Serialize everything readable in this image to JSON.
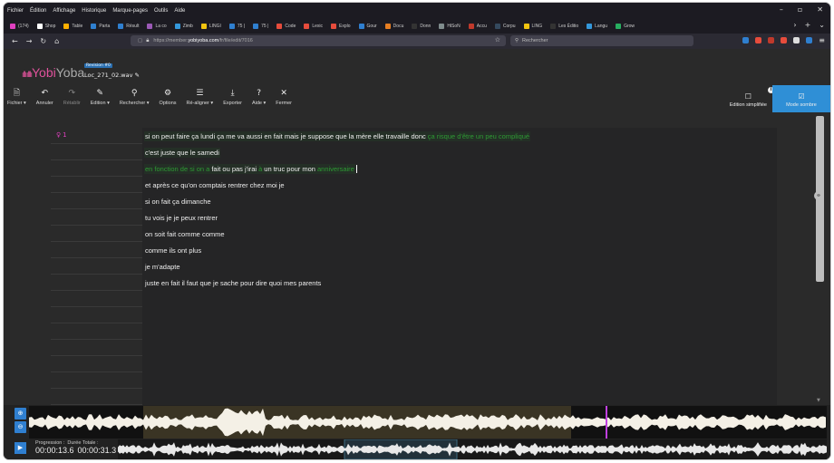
{
  "menu": [
    "Fichier",
    "Édition",
    "Affichage",
    "Historique",
    "Marque-pages",
    "Outils",
    "Aide"
  ],
  "tabs": [
    {
      "label": "(174)",
      "color": "#e040c0"
    },
    {
      "label": "Shop",
      "color": "#ffffff"
    },
    {
      "label": "Table",
      "color": "#ffb000"
    },
    {
      "label": "Parta",
      "color": "#2f7fd0"
    },
    {
      "label": "Résult",
      "color": "#2f7fd0"
    },
    {
      "label": "La co",
      "color": "#9b59b6"
    },
    {
      "label": "Zimb",
      "color": "#3498db"
    },
    {
      "label": "LINGI",
      "color": "#f1c40f"
    },
    {
      "label": "75 |",
      "color": "#2f7fd0"
    },
    {
      "label": "75 |",
      "color": "#2f7fd0"
    },
    {
      "label": "Code",
      "color": "#e74c3c"
    },
    {
      "label": "Lexic",
      "color": "#e74c3c"
    },
    {
      "label": "Explo",
      "color": "#e74c3c"
    },
    {
      "label": "Gour",
      "color": "#2f7fd0"
    },
    {
      "label": "Docu",
      "color": "#e67e22"
    },
    {
      "label": "Donn",
      "color": "#333333"
    },
    {
      "label": "HiSoN",
      "color": "#7f8c8d"
    },
    {
      "label": "Accu",
      "color": "#c0392b"
    },
    {
      "label": "Corpu",
      "color": "#34495e"
    },
    {
      "label": "LING",
      "color": "#f1c40f"
    },
    {
      "label": "Les Éditio",
      "color": "#333333"
    },
    {
      "label": "Langu",
      "color": "#3498db"
    },
    {
      "label": "Grow",
      "color": "#27ae60"
    }
  ],
  "nav": {
    "url_prefix": "https://member.",
    "url_domain": "yobiyoba.com",
    "url_path": "/fr/file/edit/7016",
    "search_placeholder": "Rechercher"
  },
  "extension_colors": [
    "#2f7fd0",
    "#e74c3c",
    "#c0392b",
    "#e74c3c",
    "#dddddd",
    "#2f7fd0"
  ],
  "app": {
    "logo_wave": "ıllıılllı",
    "logo_a": "Yobi",
    "logo_b": "Yoba",
    "revision": "Revision #0",
    "filename": "Loc_271_02.wav"
  },
  "toolbar": [
    {
      "icon": "🗎",
      "label": "Fichier ▾",
      "name": "file-menu-button",
      "dim": false
    },
    {
      "icon": "↶",
      "label": "Annuler",
      "name": "undo-button",
      "dim": false
    },
    {
      "icon": "↷",
      "label": "Rétablir",
      "name": "redo-button",
      "dim": true
    },
    {
      "icon": "✎",
      "label": "Edition ▾",
      "name": "edition-menu-button",
      "dim": false
    },
    {
      "icon": "⚲",
      "label": "Rechercher ▾",
      "name": "search-menu-button",
      "dim": false
    },
    {
      "icon": "⚙",
      "label": "Options",
      "name": "options-button",
      "dim": false
    },
    {
      "icon": "☰",
      "label": "Ré-aligner ▾",
      "name": "realign-button",
      "dim": false
    },
    {
      "icon": "⤓",
      "label": "Exporter",
      "name": "export-button",
      "dim": false
    },
    {
      "icon": "?",
      "label": "Aide ▾",
      "name": "help-button",
      "dim": false
    },
    {
      "icon": "✕",
      "label": "Fermer",
      "name": "close-button",
      "dim": false
    }
  ],
  "toolbar_right": {
    "simplified": "Edition simplifiée",
    "dark": "Mode sombre"
  },
  "speaker": "1",
  "lines": [
    [
      {
        "t": "si on peut faire ça lundi ça me va aussi en fait mais je suppose que la mère elle travaille donc ",
        "c": "hl"
      },
      {
        "t": "ça risque d'être un peu compliqué",
        "c": "g"
      }
    ],
    [
      {
        "t": "c'est juste que le samedi",
        "c": "hl"
      }
    ],
    [
      {
        "t": "en fonction de si on a ",
        "c": "g"
      },
      {
        "t": "fait ou pas j'irai ",
        "c": "hl"
      },
      {
        "t": "à",
        "c": "g"
      },
      {
        "t": " un truc pour mon ",
        "c": "hl"
      },
      {
        "t": "anniversaire",
        "c": "g"
      }
    ],
    [
      {
        "t": "et après ce qu'on comptais rentrer chez moi je",
        "c": ""
      }
    ],
    [
      {
        "t": "si on fait ça dimanche",
        "c": ""
      }
    ],
    [
      {
        "t": "tu vois je je peux rentrer",
        "c": ""
      }
    ],
    [
      {
        "t": "on soit fait comme comme",
        "c": ""
      }
    ],
    [
      {
        "t": "comme ils ont plus",
        "c": ""
      }
    ],
    [
      {
        "t": "je m'adapte",
        "c": ""
      }
    ],
    [
      {
        "t": "juste en fait il faut que je sache pour dire quoi mes parents",
        "c": ""
      }
    ]
  ],
  "player": {
    "progress_label": "Progression :",
    "progress_value": "00:00:13.6",
    "duration_label": "Durée Totale :",
    "duration_value": "00:00:31.3"
  }
}
